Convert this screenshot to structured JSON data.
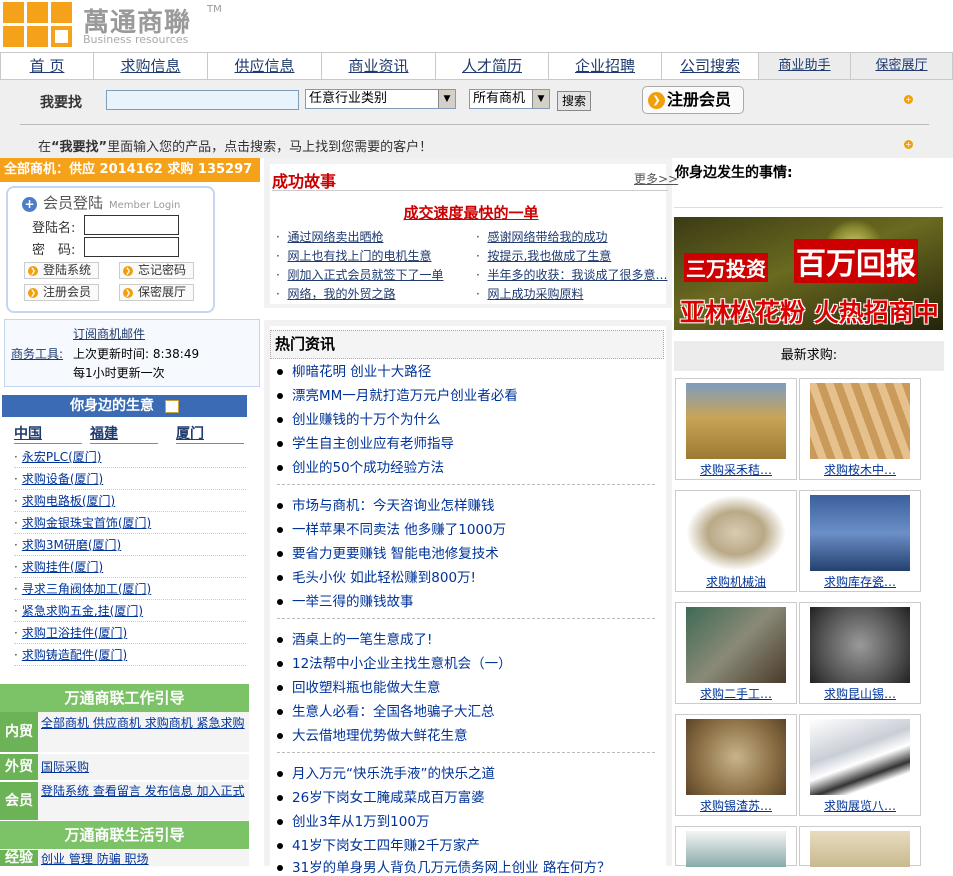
{
  "logo": {
    "cn": "萬通商聯",
    "tm": "TM",
    "en": "Business resources"
  },
  "nav": {
    "items": [
      "首 页",
      "求购信息",
      "供应信息",
      "商业资讯",
      "人才简历",
      "企业招聘",
      "公司搜索"
    ],
    "small": [
      "商业助手",
      "保密展厅"
    ]
  },
  "search": {
    "label": "我要找",
    "industry": "任意行业类别",
    "type": "所有商机",
    "button": "搜索",
    "register": "注册会员",
    "hint_pre": "在",
    "hint_bold": "“我要找”",
    "hint_post": "里面输入您的产品，点击搜索，马上找到您需要的客户！"
  },
  "stat": "全部商机：供应 2014162 求购 135297",
  "login": {
    "title": "会员登陆",
    "title_en": "Member Login",
    "user_label": "登陆名:",
    "pass_label": "密　码:",
    "buttons": [
      "登陆系统",
      "忘记密码",
      "注册会员",
      "保密展厅"
    ]
  },
  "tools": {
    "subscribe": "订阅商机邮件",
    "label": "商务工具:",
    "updated": "上次更新时间: 8:38:49",
    "freq": "每1小时更新一次"
  },
  "nearby": {
    "title": "你身边的生意",
    "tabs": [
      "中国",
      "福建",
      "厦门"
    ],
    "items": [
      "永宏PLC(厦门)",
      "求购设备(厦门)",
      "求购电路板(厦门)",
      "求购金银珠宝首饰(厦门)",
      "求购3M研磨(厦门)",
      "求购挂件(厦门)",
      "寻求三角阀体加工(厦门)",
      "紧急求购五金,挂(厦门)",
      "求购卫浴挂件(厦门)",
      "求购铸造配件(厦门)"
    ]
  },
  "guide": {
    "work_title": "万通商联工作引导",
    "rows": [
      {
        "label": "内贸",
        "links": [
          "全部商机",
          "供应商机",
          "求购商机",
          "紧急求购"
        ]
      },
      {
        "label": "外贸",
        "links": [
          "国际采购"
        ]
      },
      {
        "label": "会员",
        "links": [
          "登陆系统",
          "查看留言",
          "发布信息",
          "加入正式"
        ]
      }
    ],
    "life_title": "万通商联生活引导",
    "life_row": {
      "label": "经验",
      "links": [
        "创业",
        "管理",
        "防骗",
        "职场"
      ]
    }
  },
  "story": {
    "title": "成功故事",
    "more": "更多>>",
    "headline": "成交速度最快的一单",
    "left": [
      "通过网络卖出晒枪",
      "网上也有找上门的电机生意",
      "刚加入正式会员就签下了一单",
      "网络，我的外贸之路"
    ],
    "right": [
      "感谢网络带给我的成功",
      "按提示,我也做成了生意",
      "半年多的收获：我谈成了很多意…",
      "网上成功采购原料"
    ]
  },
  "hot": {
    "title": "热门资讯",
    "groups": [
      [
        "柳暗花明 创业十大路径",
        "漂亮MM一月就打造万元户创业者必看",
        "创业赚钱的十万个为什么",
        "学生自主创业应有老师指导",
        "创业的50个成功经验方法"
      ],
      [
        "市场与商机：今天咨询业怎样赚钱",
        "一样苹果不同卖法 他多赚了1000万",
        "要省力更要赚钱 智能电池修复技术",
        "毛头小伙 如此轻松赚到800万!",
        "一举三得的赚钱故事"
      ],
      [
        "酒桌上的一笔生意成了!",
        "12法帮中小企业主找生意机会（一）",
        "回收塑料瓶也能做大生意",
        "生意人必看：全国各地骗子大汇总",
        "大云借地理优势做大鲜花生意"
      ],
      [
        "月入万元“快乐洗手液”的快乐之道",
        "26岁下岗女工腌咸菜成百万富婆",
        "创业3年从1万到100万",
        "41岁下岗女工四年赚2千万家产",
        "31岁的单身男人背负几万元债务网上创业 路在何方？"
      ]
    ]
  },
  "right": {
    "title": "你身边发生的事情:",
    "banner_top_left": "三万投资",
    "banner_top_right": "百万回报",
    "banner_bottom": "亚林松花粉 火热招商中",
    "latest": "最新求购:",
    "thumbs": [
      "求购采禾秸…",
      "求购桉木中…",
      "求购机械油",
      "求购库存瓷…",
      "求购二手工…",
      "求购昆山锡…",
      "求购锡渣苏…",
      "求购展览八…"
    ]
  }
}
